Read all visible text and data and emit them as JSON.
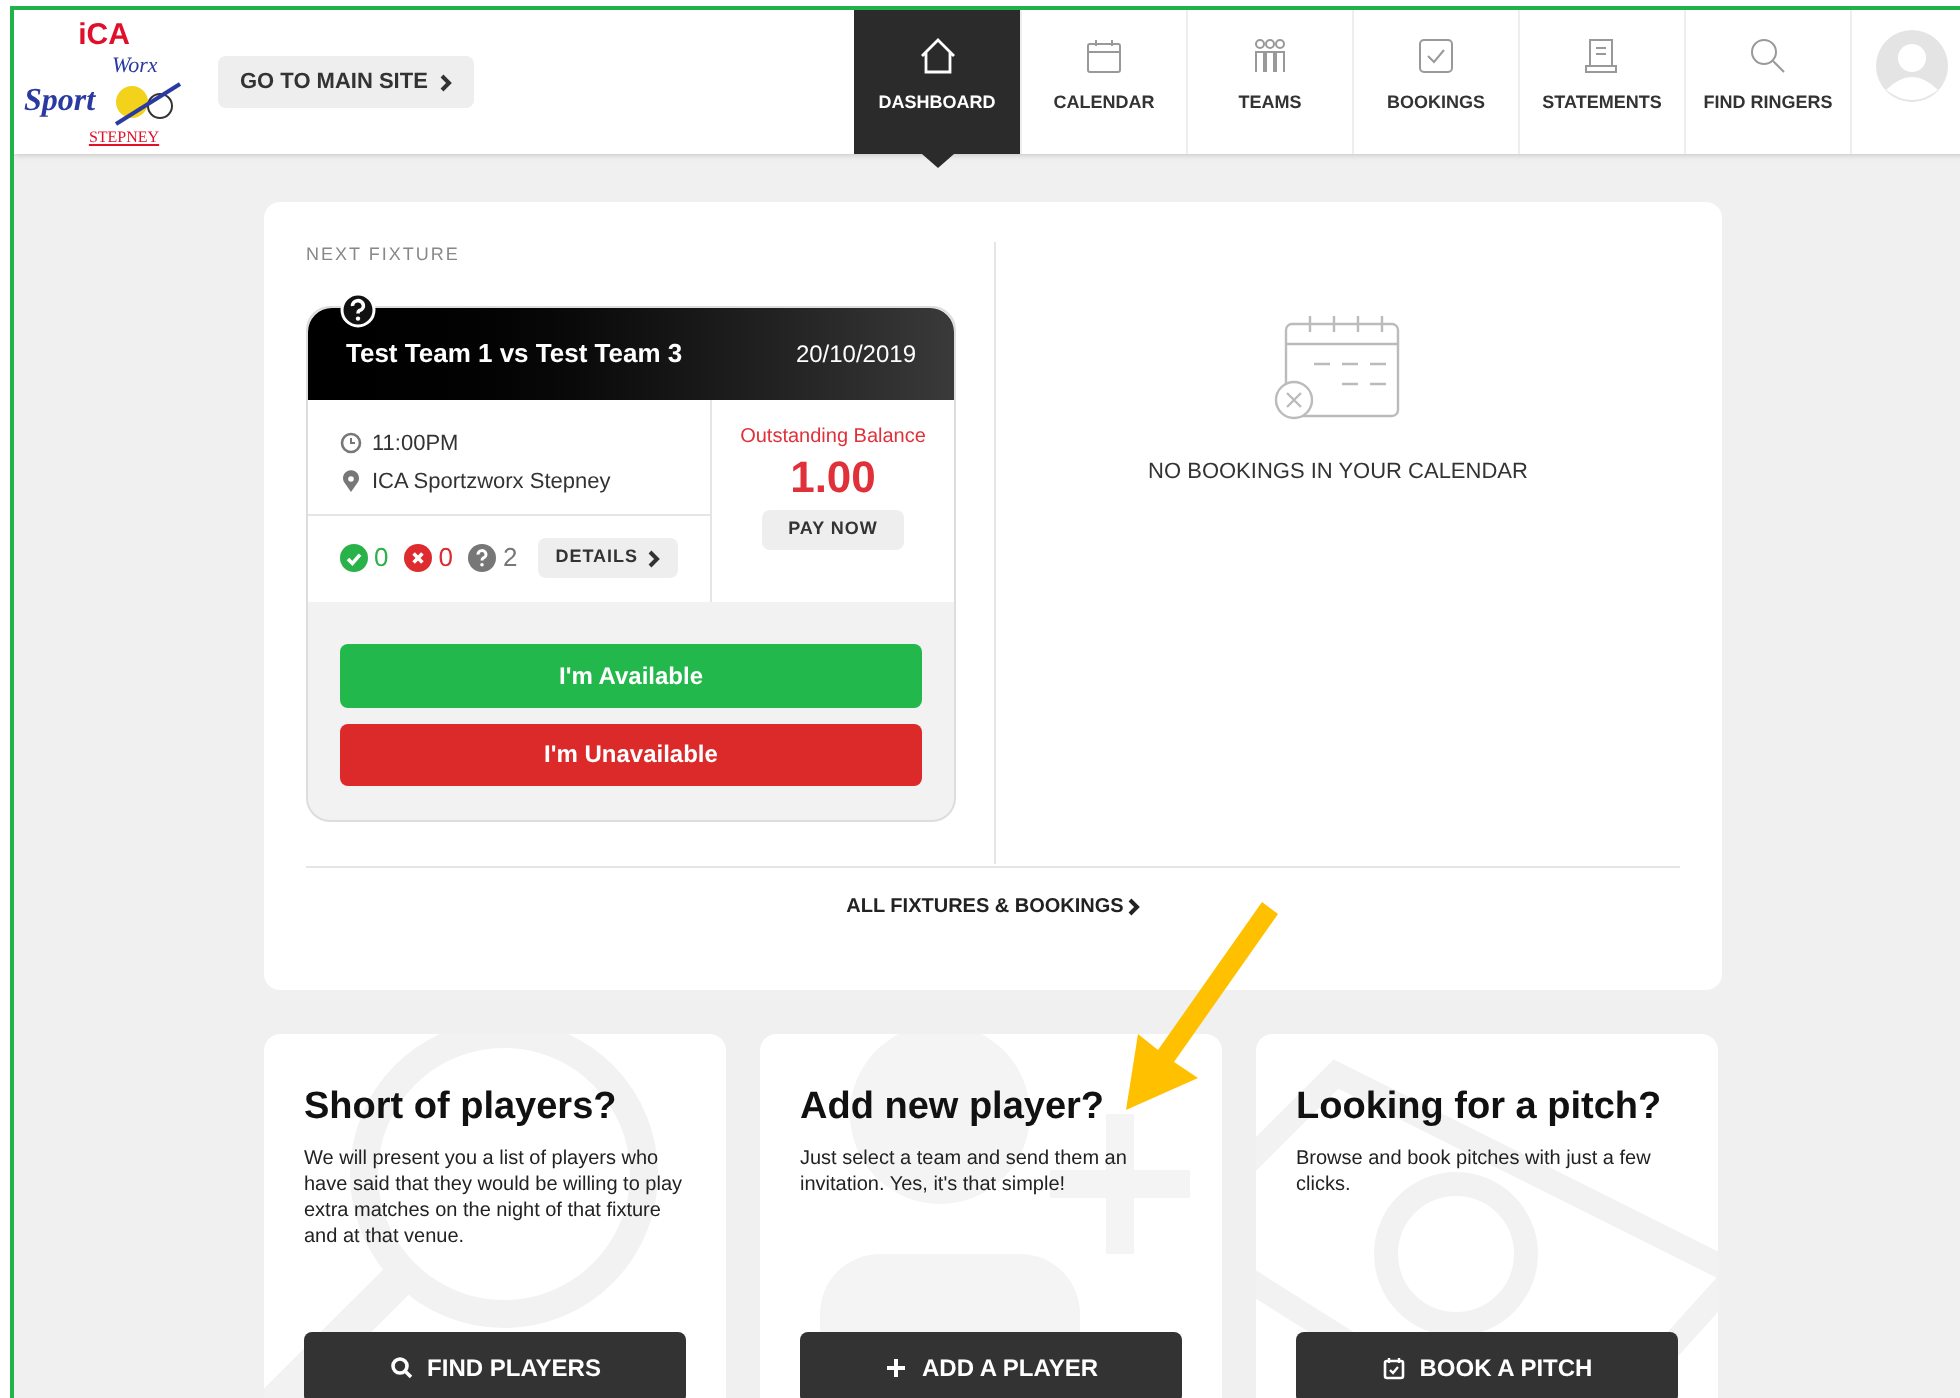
{
  "logo": {
    "top": "iCA",
    "script_1": "Sport",
    "script_2": "Worx",
    "bottom": "STEPNEY"
  },
  "main_site_button": "GO TO MAIN SITE",
  "nav": [
    {
      "label": "DASHBOARD",
      "selected": true
    },
    {
      "label": "CALENDAR",
      "selected": false
    },
    {
      "label": "TEAMS",
      "selected": false
    },
    {
      "label": "BOOKINGS",
      "selected": false
    },
    {
      "label": "STATEMENTS",
      "selected": false
    },
    {
      "label": "FIND RINGERS",
      "selected": false
    }
  ],
  "next_fixture": {
    "heading": "NEXT FIXTURE",
    "title": "Test Team 1 vs Test Team 3",
    "date": "20/10/2019",
    "time": "11:00PM",
    "venue": "ICA Sportzworx Stepney",
    "counts": [
      {
        "kind": "yes",
        "value": "0"
      },
      {
        "kind": "no",
        "value": "0"
      },
      {
        "kind": "unknown",
        "value": "2"
      }
    ],
    "details_button": "DETAILS",
    "balance_label": "Outstanding Balance",
    "balance": "1.00",
    "pay_button": "PAY NOW",
    "available_button": "I'm Available",
    "unavailable_button": "I'm Unavailable"
  },
  "calendar_empty": "NO BOOKINGS IN YOUR CALENDAR",
  "all_fixtures_link": "ALL FIXTURES & BOOKINGS",
  "cards": [
    {
      "kind": "find",
      "title": "Short of players?",
      "text": "We will present you a list of players who have said that they would be willing to play extra matches on the night of that fixture and at that venue.",
      "button": "FIND PLAYERS"
    },
    {
      "kind": "add",
      "title": "Add new player?",
      "text": "Just select a team and send them an invitation. Yes, it's that simple!",
      "button": "ADD A PLAYER"
    },
    {
      "kind": "book",
      "title": "Looking for a pitch?",
      "text": "Browse and book pitches with just a few clicks.",
      "button": "BOOK A PITCH"
    }
  ]
}
